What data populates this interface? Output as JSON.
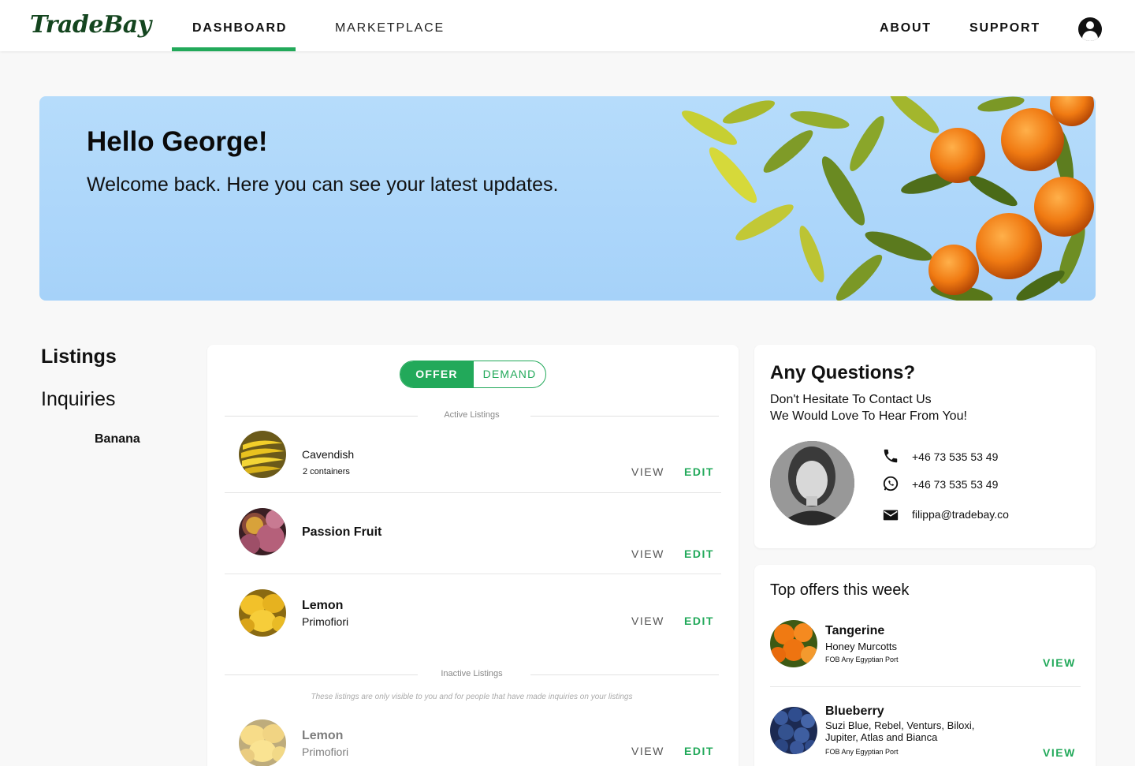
{
  "nav": {
    "logo": "TradeBay",
    "items": [
      {
        "label": "DASHBOARD",
        "active": true
      },
      {
        "label": "MARKETPLACE",
        "active": false
      },
      {
        "label": "ABOUT",
        "active": false
      },
      {
        "label": "SUPPORT",
        "active": false
      }
    ],
    "account_icon": "account-circle-icon"
  },
  "hero": {
    "title": "Hello George!",
    "subtitle": "Welcome back. Here you can see your latest updates."
  },
  "side_menu": {
    "items": [
      {
        "label": "Listings",
        "active": true
      },
      {
        "label": "Inquiries",
        "active": false
      }
    ]
  },
  "listings": {
    "toggle": {
      "offer": "OFFER",
      "demand": "DEMAND",
      "selected": "OFFER"
    },
    "active_label": "Active Listings",
    "inactive_label": "Inactive Listings",
    "inactive_note": "These listings are only visible to you and for people that have made inquiries on your listings",
    "view_label": "VIEW",
    "edit_label": "EDIT",
    "active_items": [
      {
        "name": "Banana",
        "variety": "Cavendish",
        "quantity": "2 containers"
      },
      {
        "name": "Passion Fruit",
        "variety": "",
        "quantity": ""
      },
      {
        "name": "Lemon",
        "variety": "Primofiori",
        "quantity": ""
      }
    ],
    "inactive_items": [
      {
        "name": "Lemon",
        "variety": "Primofiori",
        "quantity": ""
      }
    ]
  },
  "contact": {
    "title": "Any Questions?",
    "line1": "Don't Hesitate To Contact Us",
    "line2": "We Would Love To Hear From You!",
    "phone": "+46 73 535 53 49",
    "whatsapp": "+46 73 535 53 49",
    "email": "filippa@tradebay.co"
  },
  "top_offers": {
    "title": "Top offers this week",
    "view_label": "VIEW",
    "items": [
      {
        "name": "Tangerine",
        "variety": "Honey Murcotts",
        "port": "FOB Any Egyptian Port"
      },
      {
        "name": "Blueberry",
        "variety": "Suzi Blue, Rebel, Venturs, Biloxi, Jupiter, Atlas and Bianca",
        "port": "FOB Any Egyptian Port"
      }
    ]
  },
  "colors": {
    "accent": "#22a95a",
    "logo": "#14451f",
    "hero_bg": "#b6dcfb"
  }
}
